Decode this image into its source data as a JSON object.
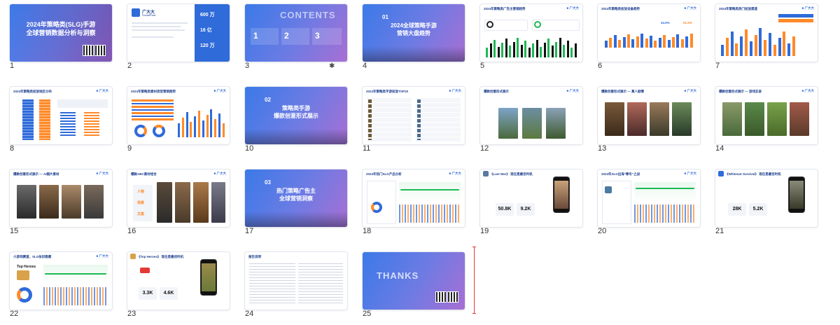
{
  "slides": [
    {
      "n": "1",
      "title": "2024年策略类(SLG)手游",
      "subtitle": "全球营销数据分析与洞察"
    },
    {
      "n": "2",
      "brand": "广大大",
      "brand_en": "SocialPeta",
      "stats": [
        "600 万",
        "16 亿",
        "120 万"
      ]
    },
    {
      "n": "3",
      "heading": "CONTENTS",
      "toc": [
        "1",
        "2",
        "3"
      ],
      "starred": true
    },
    {
      "n": "4",
      "sec_no": "01",
      "title": "2024全球策略手游",
      "subtitle": "营销大盘趋势"
    },
    {
      "n": "5",
      "title": "2024年策略类广告主营销趋势"
    },
    {
      "n": "6",
      "title": "2024年策略类投放设备趋势",
      "pcts": [
        "44.5%",
        "51.5%"
      ]
    },
    {
      "n": "7",
      "title": "2024年策略类热门投放渠道"
    },
    {
      "n": "8",
      "title": "2024年策略类投放地区分布"
    },
    {
      "n": "9",
      "title": "2024年策略类素材类型营销趋势"
    },
    {
      "n": "10",
      "sec_no": "02",
      "title": "策略类手游",
      "subtitle": "爆款创意形式展示"
    },
    {
      "n": "11",
      "title": "2024年策略类手游投放TOP20"
    },
    {
      "n": "12",
      "title": "爆款创意形式展示"
    },
    {
      "n": "13",
      "title": "爆款创意形式展示 — 真人剧情"
    },
    {
      "n": "14",
      "title": "爆款创意形式展示 — 游戏实录"
    },
    {
      "n": "15",
      "title": "爆款创意形式展示 — AI图片素材"
    },
    {
      "n": "16",
      "title": "爆款ABC素材组合",
      "items": [
        "人物",
        "场景",
        "文案"
      ]
    },
    {
      "n": "17",
      "sec_no": "03",
      "title": "热门策略广告主",
      "subtitle": "全球营销洞察"
    },
    {
      "n": "18",
      "title": "2024年热门SLG产品分析"
    },
    {
      "n": "19",
      "title": "《Last War》 现在是最佳时机",
      "numbers": [
        "50.8K",
        "9.2K"
      ]
    },
    {
      "n": "20",
      "title": "2024年SLG出海\"寒冬\"之战"
    },
    {
      "n": "21",
      "title": "《Whiteout Survival》 现在是最佳时机",
      "numbers": [
        "28K",
        "5.2K"
      ]
    },
    {
      "n": "22",
      "title": "小游戏赛道，SLG依旧稳健",
      "game": "Top Heroes"
    },
    {
      "n": "23",
      "title": "《Top Heroes》 现在是最佳时机",
      "numbers": [
        "3.3K",
        "4.6K"
      ]
    },
    {
      "n": "24",
      "title": "报告说明"
    },
    {
      "n": "25",
      "title": "THANKS"
    }
  ],
  "colors": {
    "accent": "#2f6bd9",
    "purple": "#8a6fe0",
    "orange": "#ff8a2a",
    "green": "#1db954",
    "red": "#e53935"
  }
}
